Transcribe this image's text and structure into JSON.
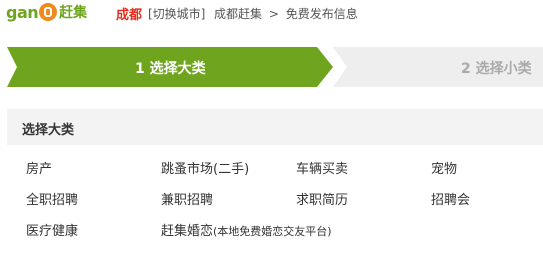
{
  "header": {
    "logo_word": "gan",
    "logo_name": "赶集",
    "city": "成都",
    "switch_city": "[切换城市]",
    "breadcrumb": [
      "成都赶集",
      "免费发布信息"
    ],
    "breadcrumb_sep": ">"
  },
  "steps": [
    {
      "label": "1 选择大类",
      "state": "active"
    },
    {
      "label": "2 选择小类",
      "state": "inactive"
    }
  ],
  "colors": {
    "accent": "#6fa41f",
    "city": "#e0301e",
    "step_inactive": "#eeeeee"
  },
  "panel": {
    "title": "选择大类",
    "categories": [
      [
        "房产",
        "跳蚤市场(二手)",
        "车辆买卖",
        "宠物"
      ],
      [
        "全职招聘",
        "兼职招聘",
        "求职简历",
        "招聘会"
      ],
      [
        "医疗健康",
        "赶集婚恋"
      ]
    ],
    "marriage_note": "(本地免费婚恋交友平台)"
  }
}
